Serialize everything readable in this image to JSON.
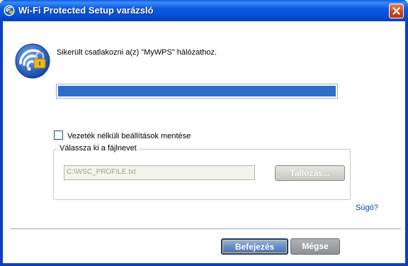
{
  "window": {
    "title": "Wi-Fi Protected Setup varázsló",
    "title_icon": "wps-app-icon",
    "close_icon": "close-icon"
  },
  "status": {
    "icon": "wps-lock-icon",
    "message": "Sikerült csatlakozni a(z) \"MyWPS\" hálózathoz."
  },
  "progress": {
    "value_percent": 100,
    "color": "#2c6fcb"
  },
  "save_settings": {
    "label": "Vezeték nélküli beállítások mentése",
    "checked": false
  },
  "file_group": {
    "legend": "Válassza ki a fájlnevet",
    "path_value": "C:\\WSC_PROFILE.txt",
    "browse_label": "Tallózás...",
    "enabled": false
  },
  "help": {
    "label": "Súgó?"
  },
  "buttons": {
    "finish_label": "Befejezés",
    "cancel_label": "Mégse"
  }
}
